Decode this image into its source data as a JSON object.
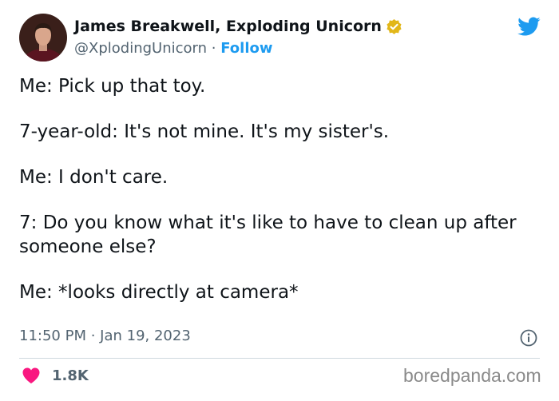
{
  "author": {
    "name": "James Breakwell, Exploding Unicorn",
    "handle": "@XplodingUnicorn",
    "separator": "·",
    "follow_label": "Follow"
  },
  "tweet": {
    "lines": [
      "Me: Pick up that toy.",
      "7-year-old: It's not mine. It's my sister's.",
      "Me: I don't care.",
      "7: Do you know what it's like to have to clean up after someone else?",
      "Me: *looks directly at camera*"
    ],
    "timestamp": "11:50 PM · Jan 19, 2023"
  },
  "engagement": {
    "likes": "1.8K"
  },
  "watermark": "boredpanda.com",
  "icons": {
    "verified": "verified-badge-icon",
    "twitter": "twitter-bird-icon",
    "info": "info-icon",
    "like": "heart-icon"
  },
  "colors": {
    "accent": "#1d9bf0",
    "verified_gold": "#e2b719",
    "like_pink": "#f91880",
    "secondary_text": "#536471"
  }
}
